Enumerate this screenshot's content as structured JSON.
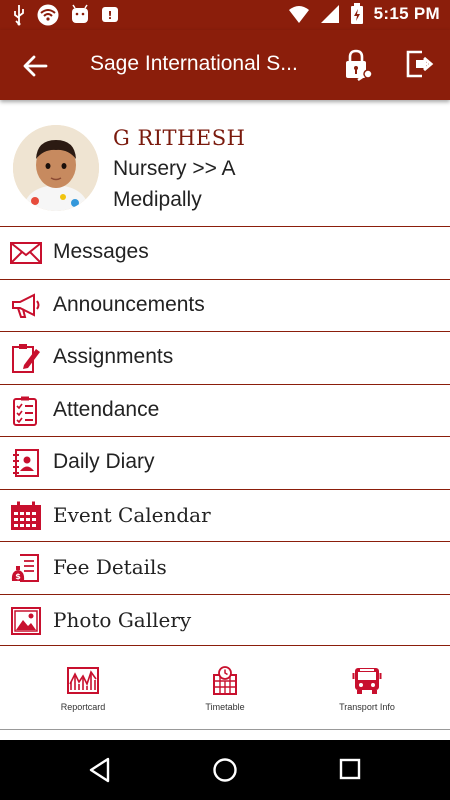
{
  "status_bar": {
    "time": "5:15 PM",
    "battery_icon": "battery-icon",
    "wifi_icon": "wifi-icon",
    "signal_icon": "signal-icon"
  },
  "app_bar": {
    "title": "Sage  International S...",
    "back_icon": "arrow-left-icon",
    "lock_icon": "lock-key-icon",
    "logout_icon": "logout-icon"
  },
  "profile": {
    "name": "G RITHESH",
    "class_section": "Nursery >> A",
    "branch": "Medipally"
  },
  "menu": {
    "items": [
      {
        "label": "Messages",
        "icon": "envelope-icon"
      },
      {
        "label": "Announcements",
        "icon": "megaphone-icon"
      },
      {
        "label": "Assignments",
        "icon": "clipboard-pencil-icon"
      },
      {
        "label": "Attendance",
        "icon": "checklist-icon"
      },
      {
        "label": "Daily Diary",
        "icon": "diary-icon"
      },
      {
        "label": "Event Calendar",
        "icon": "calendar-icon"
      },
      {
        "label": "Fee Details",
        "icon": "fee-receipt-icon"
      },
      {
        "label": "Photo Gallery",
        "icon": "photo-icon"
      }
    ]
  },
  "bottom_tabs": [
    {
      "label": "Reportcard",
      "icon": "reportcard-icon"
    },
    {
      "label": "Timetable",
      "icon": "timetable-icon"
    },
    {
      "label": "Transport Info",
      "icon": "bus-icon"
    }
  ],
  "colors": {
    "primary": "#8b1e0b",
    "divider": "#8b1e0b",
    "icon": "#c8102e"
  }
}
